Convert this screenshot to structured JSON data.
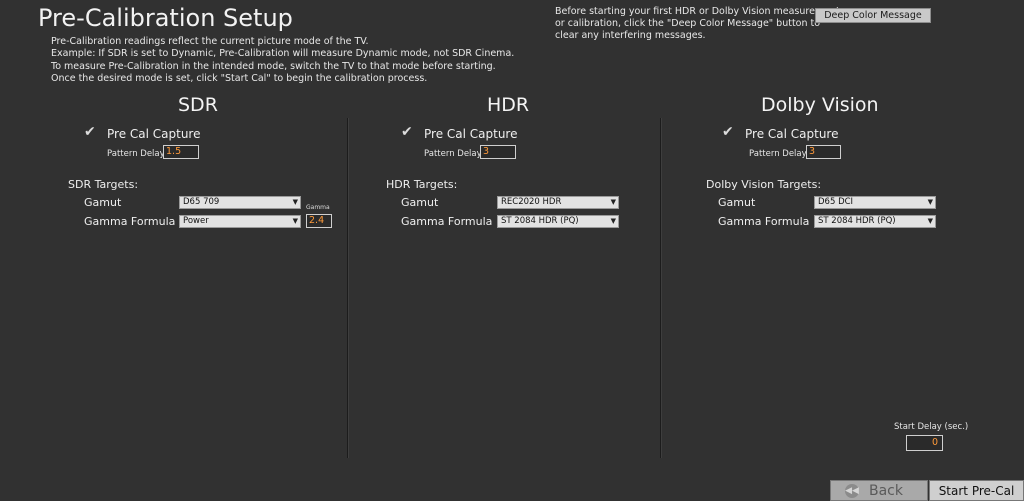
{
  "page": {
    "title": "Pre-Calibration Setup",
    "intro_lines": [
      "Pre-Calibration readings reflect the current picture mode of the TV.",
      "Example: If SDR is set to Dynamic, Pre-Calibration will measure Dynamic mode, not SDR Cinema.",
      "To measure Pre-Calibration in the intended mode, switch the TV to that mode before starting.",
      "Once the desired mode is set, click \"Start Cal\" to begin the calibration process."
    ],
    "note_lines": [
      "Before starting your first HDR or Dolby Vision measurement",
      "or calibration, click the \"Deep Color Message\" button to",
      "clear any interfering messages."
    ],
    "deep_color_button": "Deep Color Message"
  },
  "sdr": {
    "title": "SDR",
    "capture_label": "Pre Cal Capture",
    "capture_checked": true,
    "pattern_delay_label": "Pattern Delay:",
    "pattern_delay_value": "1.5",
    "targets_label": "SDR Targets:",
    "gamut_label": "Gamut",
    "gamut_value": "D65  709",
    "gamma_formula_label": "Gamma Formula",
    "gamma_formula_value": "Power",
    "gamma_label": "Gamma",
    "gamma_value": "2.4"
  },
  "hdr": {
    "title": "HDR",
    "capture_label": "Pre Cal Capture",
    "capture_checked": true,
    "pattern_delay_label": "Pattern Delay:",
    "pattern_delay_value": "3",
    "targets_label": "HDR Targets:",
    "gamut_label": "Gamut",
    "gamut_value": "REC2020  HDR",
    "gamma_formula_label": "Gamma Formula",
    "gamma_formula_value": "ST 2084 HDR (PQ)"
  },
  "dv": {
    "title": "Dolby Vision",
    "capture_label": "Pre Cal Capture",
    "capture_checked": true,
    "pattern_delay_label": "Pattern Delay:",
    "pattern_delay_value": "3",
    "targets_label": "Dolby Vision Targets:",
    "gamut_label": "Gamut",
    "gamut_value": "D65  DCI",
    "gamma_formula_label": "Gamma Formula",
    "gamma_formula_value": "ST 2084 HDR (PQ)"
  },
  "footer": {
    "start_delay_label": "Start Delay (sec.)",
    "start_delay_value": "0",
    "back_label": "Back",
    "start_label": "Start Pre-Cal"
  },
  "icons": {
    "check": "checkmark-icon",
    "dropdown": "chevron-down-icon",
    "back": "back-arrow-icon"
  }
}
